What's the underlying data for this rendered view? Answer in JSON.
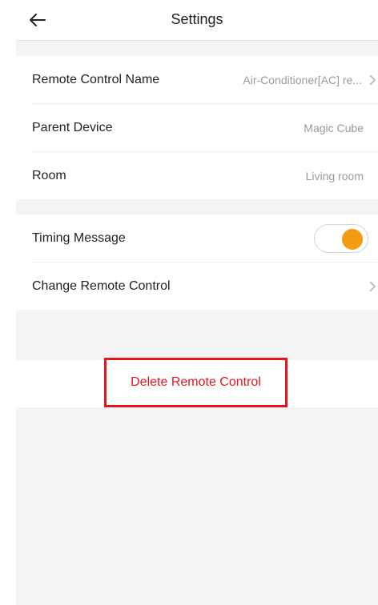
{
  "header": {
    "title": "Settings"
  },
  "group1": {
    "remote_name_label": "Remote Control Name",
    "remote_name_value": "Air-Conditioner[AC] re...",
    "parent_device_label": "Parent Device",
    "parent_device_value": "Magic Cube",
    "room_label": "Room",
    "room_value": "Living room"
  },
  "group2": {
    "timing_label": "Timing Message",
    "timing_enabled": true,
    "change_remote_label": "Change Remote Control"
  },
  "actions": {
    "delete_label": "Delete Remote Control"
  },
  "colors": {
    "accent": "#f39c12",
    "danger": "#e8141c"
  }
}
